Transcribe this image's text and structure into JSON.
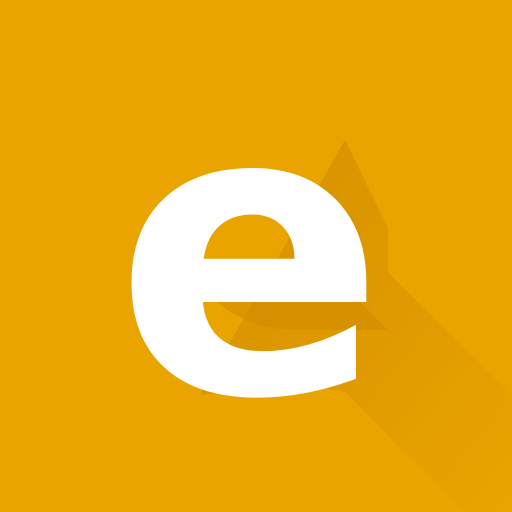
{
  "icon": {
    "letter": "e",
    "name": "letter-e-logo-icon",
    "background_color": "#e9a400",
    "letter_color": "#ffffff",
    "shadow_color": "#c98400"
  }
}
